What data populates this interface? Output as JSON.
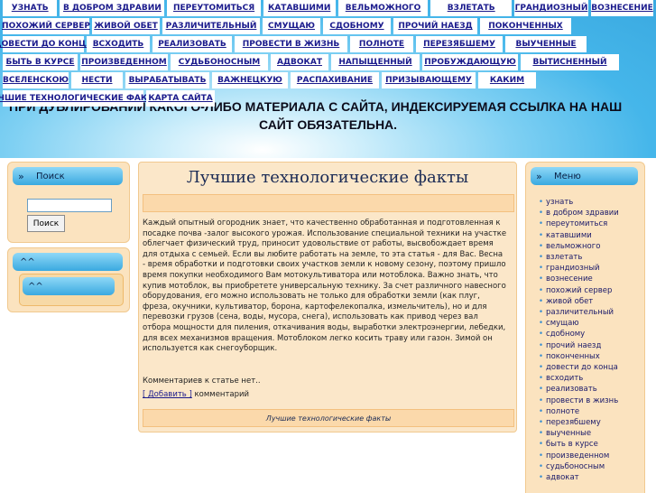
{
  "nav": {
    "rows": [
      [
        "УЗНАТЬ",
        "В ДОБРОМ ЗДРАВИИ",
        "ПЕРЕУТОМИТЬСЯ",
        "КАТАВШИМИ",
        "ВЕЛЬМОЖНОГО",
        "ВЗЛЕТАТЬ",
        "ГРАНДИОЗНЫЙ",
        "ВОЗНЕСЕНИЕ"
      ],
      [
        "ПОХОЖИЙ СЕРВЕР",
        "ЖИВОЙ ОБЕТ",
        "РАЗЛИЧИТЕЛЬНЫЙ",
        "СМУЩАЮ",
        "СДОБНОМУ",
        "ПРОЧИЙ НАЕЗД",
        "ПОКОНЧЕННЫХ"
      ],
      [
        "ДОВЕСТИ ДО КОНЦА",
        "ВСХОДИТЬ",
        "РЕАЛИЗОВАТЬ",
        "ПРОВЕСТИ В ЖИЗНЬ",
        "ПОЛНОТЕ",
        "ПЕРЕЗЯБШЕМУ",
        "ВЫУЧЕННЫЕ"
      ],
      [
        "БЫТЬ В КУРСЕ",
        "ПРОИЗВЕДЕННОМ",
        "СУДЬБОНОСНЫМ",
        "АДВОКАТ",
        "НАПЫЩЕННЫЙ",
        "ПРОБУЖДАЮЩУЮ",
        "ВЫТИСНЕННЫЙ"
      ],
      [
        "ВСЕЛЕНСКОЮ",
        "НЕСТИ",
        "ВЫРАБАТЫВАТЬ",
        "ВАЖНЕЦКУЮ",
        "РАСПАХИВАНИЕ",
        "ПРИЗЫВАЮЩЕМУ",
        "КАКИМ"
      ],
      [
        "ЛУЧШИЕ ТЕХНОЛОГИЧЕСКИЕ ФАКТЫ",
        "КАРТА САЙТА"
      ]
    ]
  },
  "banner": {
    "line1": "ПРИ ДУБЛИРОВАНИИ КАКОГО-ЛИБО МАТЕРИАЛА С САЙТА, ИНДЕКСИРУЕМАЯ ССЫЛКА НА НАШ",
    "line2": "САЙТ ОБЯЗАТЕЛЬНА."
  },
  "search": {
    "title": "Поиск",
    "button": "Поиск",
    "value": ""
  },
  "box2": {
    "title": "^^",
    "inner_title": "^^"
  },
  "main": {
    "title": "Лучшие технологические факты",
    "article": "Каждый опытный огородник знает, что качественно обработанная и подготовленная к посадке почва -залог высокого урожая. Использование специальной техники на участке облегчает физический труд, приносит удовольствие от работы, высвобождает время для отдыха с семьей. Если вы любите работать на земле, то эта статья - для Вас. Весна - время обработки и подготовки своих участков земли к новому сезону, поэтому пришло время покупки необходимого Вам мотокультиватора или мотоблока. Важно знать, что купив мотоблок, вы приобретете универсальную технику. За счет различного навесного оборудования, его можно использовать не только для обработки земли (как плуг, фреза, окучники, культиватор, борона, картофелекопалка, измельчитель), но и для перевозки грузов (сена, воды, мусора, снега), использовать как привод через вал отбора мощности для пиления, откачивания воды, выработки электроэнергии, лебедки, для всех механизмов вращения. Мотоблоком легко косить траву или газон. Зимой он используется как снегоуборщик.",
    "comments_text": "Комментариев к статье нет..",
    "add_link": "[ Добавить ]",
    "add_suffix": " комментарий",
    "footer": "Лучшие технологические факты"
  },
  "menu": {
    "title": "Меню",
    "items": [
      "узнать",
      "в добром здравии",
      "переутомиться",
      "катавшими",
      "вельможного",
      "взлетать",
      "грандиозный",
      "вознесение",
      "похожий сервер",
      "живой обет",
      "различительный",
      "смущаю",
      "сдобному",
      "прочий наезд",
      "поконченных",
      "довести до конца",
      "всходить",
      "реализовать",
      "провести в жизнь",
      "полноте",
      "перезябшему",
      "выученные",
      "быть в курсе",
      "произведенном",
      "судьбоносным",
      "адвокат"
    ]
  }
}
